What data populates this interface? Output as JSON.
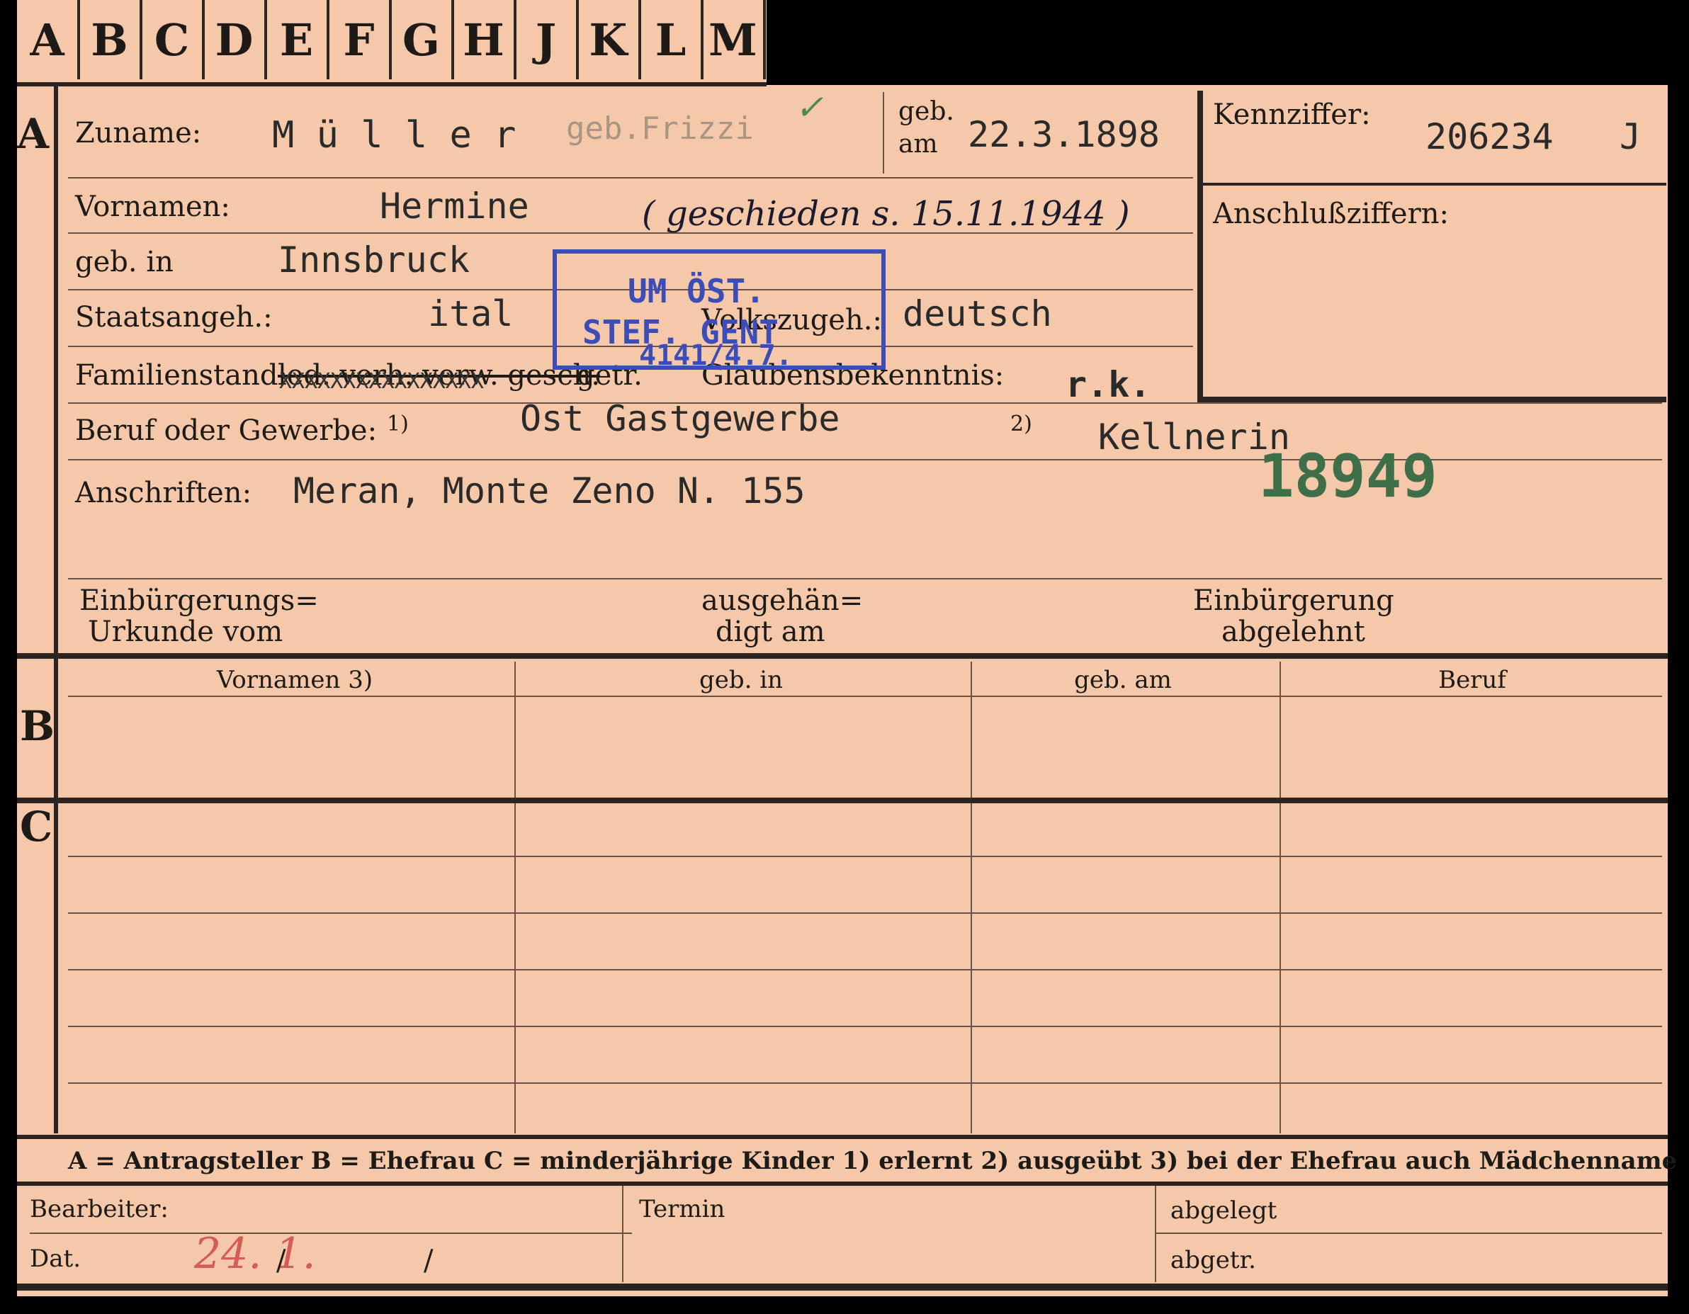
{
  "tabs": [
    "A",
    "B",
    "C",
    "D",
    "E",
    "F",
    "G",
    "H",
    "J",
    "K",
    "L",
    "M"
  ],
  "rows": {
    "a": "A",
    "b": "B",
    "c": "C"
  },
  "labels": {
    "zuname": "Zuname:",
    "vornamen": "Vornamen:",
    "geb_in": "geb. in",
    "staatsangeh": "Staatsangeh.:",
    "volkszugeh": "Volkszugeh.:",
    "familienstand": "Familienstand:",
    "familienstand_options": "led. verh. verw. gesch.",
    "familienstand_getr": "getr.",
    "glaubens": "Glaubensbekenntnis:",
    "beruf": "Beruf oder Gewerbe:",
    "beruf_note1": "1)",
    "beruf_note2": "2)",
    "anschriften": "Anschriften:",
    "geb": "geb.",
    "am": "am",
    "kennziffer": "Kennziffer:",
    "anschlussziffern": "Anschlußziffern:",
    "einb_urkunde_1": "Einbürgerungs=",
    "einb_urkunde_2": "Urkunde vom",
    "ausgeh_1": "ausgehän=",
    "ausgeh_2": "digt am",
    "einb_abg_1": "Einbürgerung",
    "einb_abg_2": "abgelehnt"
  },
  "values": {
    "zuname": "M ü l l e r",
    "zuname_geb": "geb.Frizzi",
    "check": "✓",
    "geb_am": "22.3.1898",
    "kennziffer": "206234",
    "kennziffer_suffix": "J",
    "vornamen": "Hermine",
    "geschieden_note": "( geschieden s. 15.11.1944 )",
    "geb_in": "Innsbruck",
    "staatsangeh": "ital",
    "volkszugeh": "deutsch",
    "familienstand_x": "XXXXXXXXXXXXXXXX",
    "glaubens": "r.k.",
    "beruf_1": "Ost Gastgewerbe",
    "beruf_2": "Kellnerin",
    "anschrift": "Meran, Monte Zeno N. 155",
    "stamp_number": "18949"
  },
  "stamp": {
    "line1": "UM ÖST.",
    "line2": "STEF. GENT",
    "line3": "4141/4.7.",
    "color": "#3d4db8"
  },
  "table_headers": [
    "Vornamen 3)",
    "geb. in",
    "geb. am",
    "Beruf"
  ],
  "legend": "A = Antragsteller   B = Ehefrau   C = minderjährige Kinder   1) erlernt   2) ausgeübt   3) bei der Ehefrau auch Mädchenname",
  "footer": {
    "bearbeiter": "Bearbeiter:",
    "dat": "Dat.",
    "dat_value": "24. 1.",
    "dat_slash1": "/",
    "dat_slash2": "/",
    "termin": "Termin",
    "abgelegt": "abgelegt",
    "abgetr": "abgetr."
  }
}
